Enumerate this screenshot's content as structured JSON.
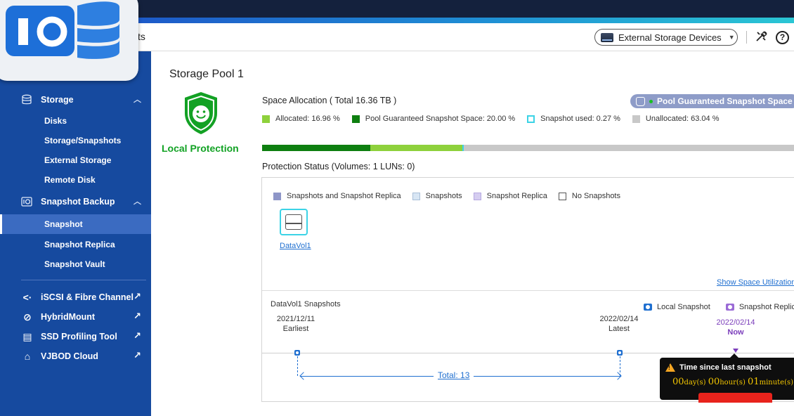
{
  "header": {
    "title_fragment": "ts",
    "external_storage_label": "External Storage Devices",
    "help_glyph": "?"
  },
  "sidebar": {
    "groups": [
      {
        "label": "Storage",
        "items": [
          "Disks",
          "Storage/Snapshots",
          "External Storage",
          "Remote Disk"
        ]
      },
      {
        "label": "Snapshot Backup",
        "items": [
          "Snapshot",
          "Snapshot Replica",
          "Snapshot Vault"
        ],
        "active_item": "Snapshot"
      }
    ],
    "links": [
      {
        "label": "iSCSI & Fibre Channel",
        "icon": "iscsi-icon",
        "glyph": "<·"
      },
      {
        "label": "HybridMount",
        "icon": "hybridmount-icon",
        "glyph": "⊘"
      },
      {
        "label": "SSD Profiling Tool",
        "icon": "ssd-icon",
        "glyph": "▤"
      },
      {
        "label": "VJBOD Cloud",
        "icon": "vjbod-cloud-icon",
        "glyph": "⌂"
      }
    ]
  },
  "main": {
    "pool_title": "Storage Pool 1",
    "protection_label": "Local Protection",
    "space_allocation_title": "Space Allocation ( Total 16.36 TB )",
    "pool_guaranteed_pill": "Pool Guaranteed Snapshot Space",
    "allocation_legend": [
      {
        "label": "Allocated: 16.96 %",
        "color": "#8ed13c",
        "value": 16.96
      },
      {
        "label": "Pool Guaranteed Snapshot Space: 20.00 %",
        "color": "#0e7f10",
        "value": 20.0
      },
      {
        "label": "Snapshot used: 0.27 %",
        "color": "#3cd3e6",
        "value": 0.27
      },
      {
        "label": "Unallocated: 63.04 %",
        "color": "#c8c8c8",
        "value": 63.04
      }
    ],
    "protection_status_title": "Protection Status (Volumes: 1 LUNs: 0)",
    "protection_legend": [
      {
        "label": "Snapshots and Snapshot Replica",
        "color": "#8e96c8"
      },
      {
        "label": "Snapshots",
        "color": "#d8e6f4"
      },
      {
        "label": "Snapshot Replica",
        "color": "#d5cdf0"
      },
      {
        "label": "No Snapshots",
        "color": "#ffffff"
      }
    ],
    "volume_name": "DataVol1",
    "show_space_link": "Show Space Utilization",
    "snapshots_title": "DataVol1 Snapshots",
    "snapshot_legend": [
      {
        "label": "Local Snapshot",
        "color": "#1f6fd0"
      },
      {
        "label": "Snapshot Replica",
        "color": "#9b6bd6"
      }
    ],
    "earliest_date": "2021/12/11",
    "earliest_label": "Earliest",
    "latest_date": "2022/02/14",
    "latest_label": "Latest",
    "now_date": "2022/02/14",
    "now_label": "Now",
    "total_label": "Total: 13",
    "tooltip": {
      "title": "Time since last snapshot",
      "days": "00",
      "days_unit": "day(s)",
      "hours": "00",
      "hours_unit": "hour(s)",
      "minutes": "01",
      "minutes_unit": "minute(s)"
    }
  }
}
